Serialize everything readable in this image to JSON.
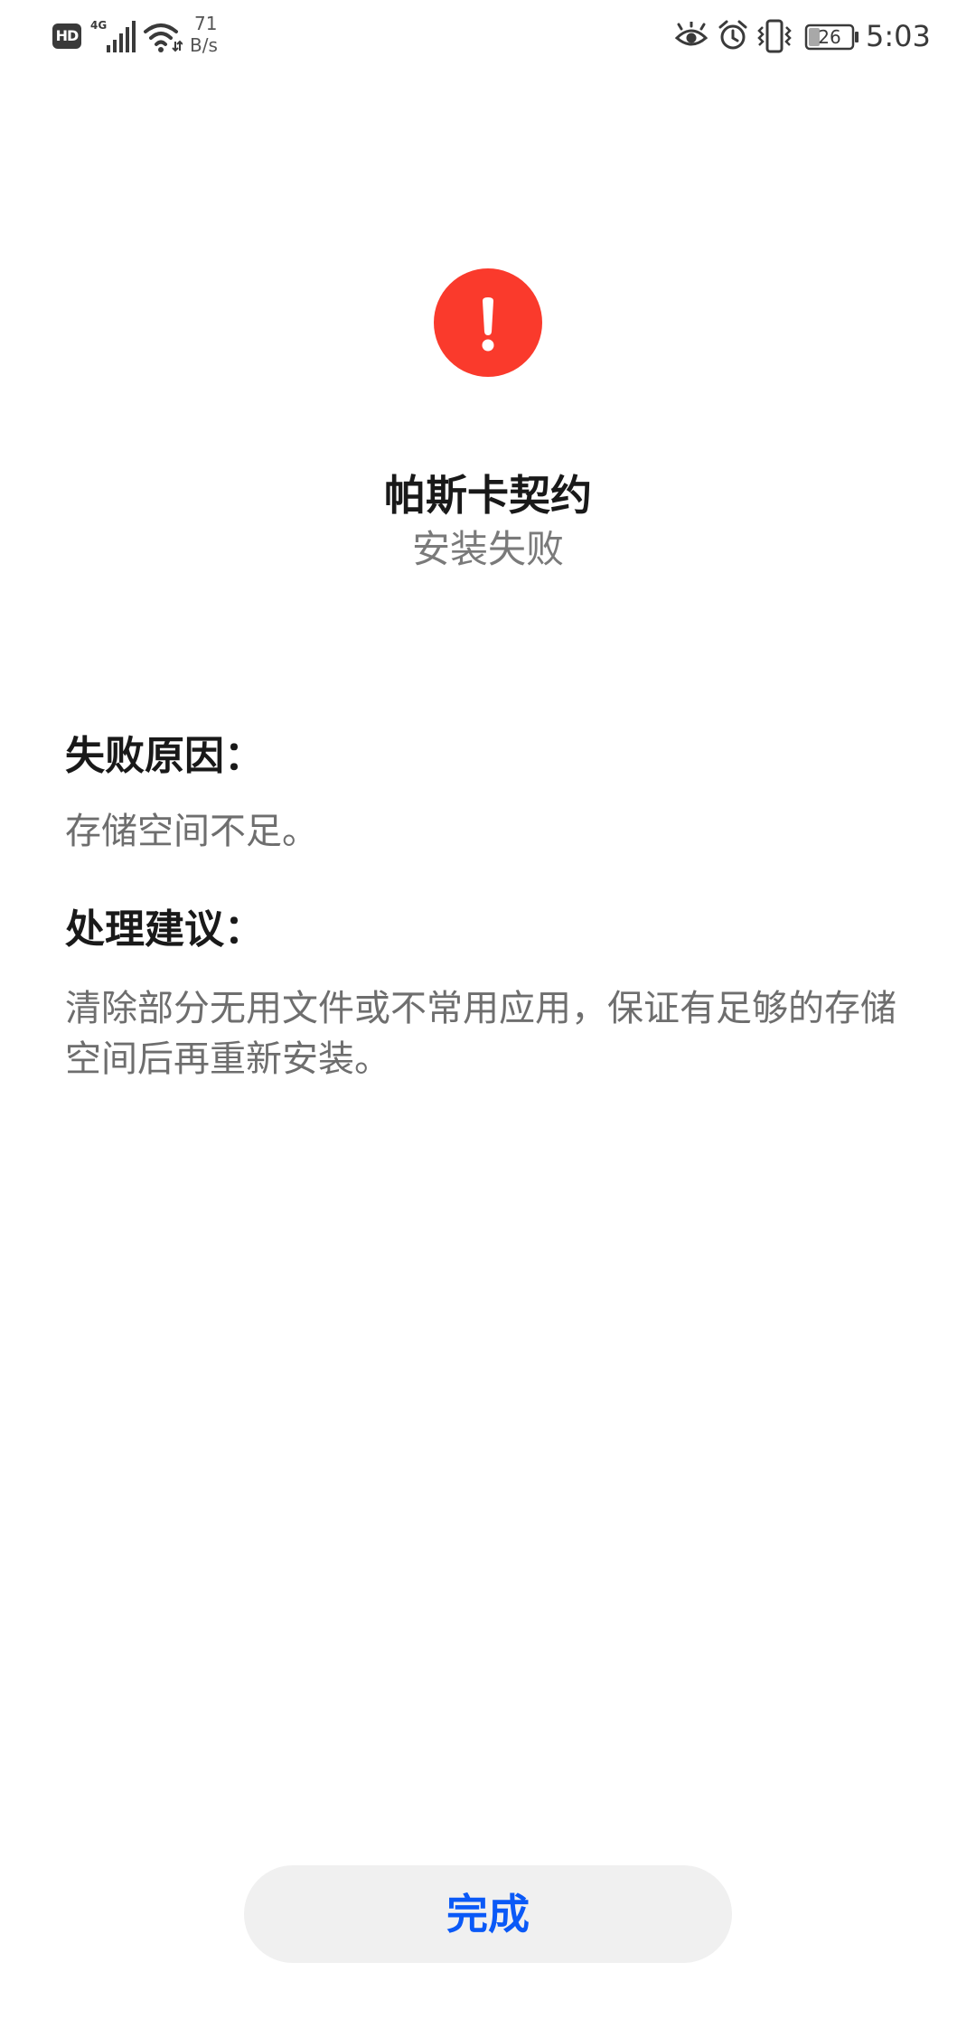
{
  "status_bar": {
    "hd_label": "HD",
    "network_type": "4G",
    "net_speed_value": "71",
    "net_speed_unit": "B/s",
    "battery_level": "26",
    "time": "5:03",
    "icons": [
      "hd-icon",
      "signal-4g-icon",
      "wifi-icon",
      "eye-comfort-icon",
      "alarm-icon",
      "vibrate-icon",
      "battery-icon"
    ]
  },
  "header": {
    "status_icon": "error-icon",
    "icon_color": "#fa3a2c",
    "app_name": "帕斯卡契约",
    "install_status": "安装失败"
  },
  "failure_reason": {
    "heading": "失败原因：",
    "text": "存储空间不足。"
  },
  "suggestion": {
    "heading": "处理建议：",
    "text": "清除部分无用文件或不常用应用，保证有足够的存储空间后再重新安装。"
  },
  "actions": {
    "done_label": "完成",
    "accent_color": "#0a59f7"
  }
}
